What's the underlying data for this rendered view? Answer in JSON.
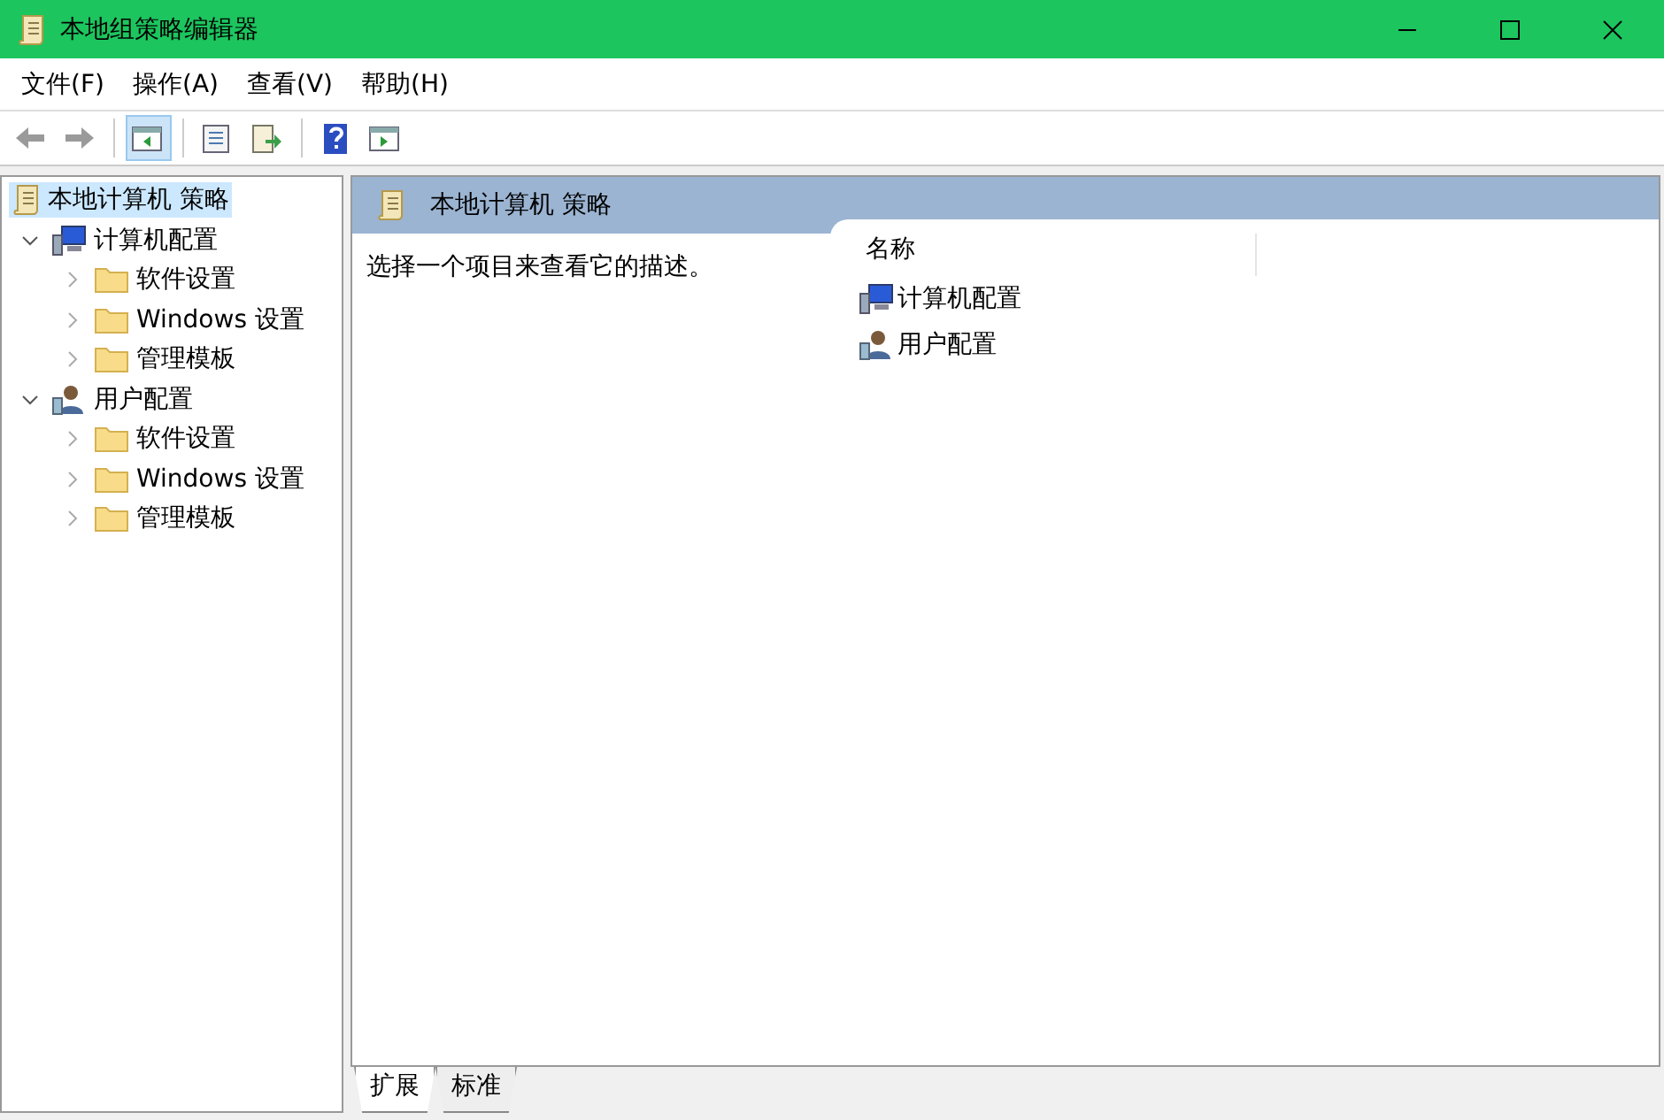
{
  "window": {
    "title": "本地组策略编辑器"
  },
  "menu": [
    {
      "label": "文件(F)"
    },
    {
      "label": "操作(A)"
    },
    {
      "label": "查看(V)"
    },
    {
      "label": "帮助(H)"
    }
  ],
  "toolbar": [
    {
      "kind": "back",
      "on": false
    },
    {
      "kind": "forward",
      "on": false
    },
    {
      "kind": "separator"
    },
    {
      "kind": "tree-toggle",
      "on": true
    },
    {
      "kind": "separator"
    },
    {
      "kind": "properties",
      "on": false
    },
    {
      "kind": "export",
      "on": false
    },
    {
      "kind": "separator"
    },
    {
      "kind": "help",
      "on": false
    },
    {
      "kind": "action-pane",
      "on": false
    }
  ],
  "tree": [
    {
      "label": "本地计算机 策略",
      "kind": "policy",
      "selected": true,
      "children": [
        {
          "label": "计算机配置",
          "kind": "computer",
          "selected": false,
          "expanded": true,
          "children": [
            {
              "label": "软件设置",
              "kind": "folder",
              "selected": false,
              "expanded": false
            },
            {
              "label": "Windows 设置",
              "kind": "folder",
              "selected": false,
              "expanded": false
            },
            {
              "label": "管理模板",
              "kind": "folder",
              "selected": false,
              "expanded": false
            }
          ]
        },
        {
          "label": "用户配置",
          "kind": "user",
          "selected": false,
          "expanded": true,
          "children": [
            {
              "label": "软件设置",
              "kind": "folder",
              "selected": false,
              "expanded": false
            },
            {
              "label": "Windows 设置",
              "kind": "folder",
              "selected": false,
              "expanded": false
            },
            {
              "label": "管理模板",
              "kind": "folder",
              "selected": false,
              "expanded": false
            }
          ]
        }
      ]
    }
  ],
  "detail": {
    "title": "本地计算机 策略",
    "description": "选择一个项目来查看它的描述。",
    "columns": [
      "名称"
    ],
    "items": [
      {
        "label": "计算机配置",
        "kind": "computer"
      },
      {
        "label": "用户配置",
        "kind": "user"
      }
    ]
  },
  "bottom_tabs": [
    {
      "label": "扩展",
      "selected": true
    },
    {
      "label": "标准",
      "selected": false
    }
  ]
}
